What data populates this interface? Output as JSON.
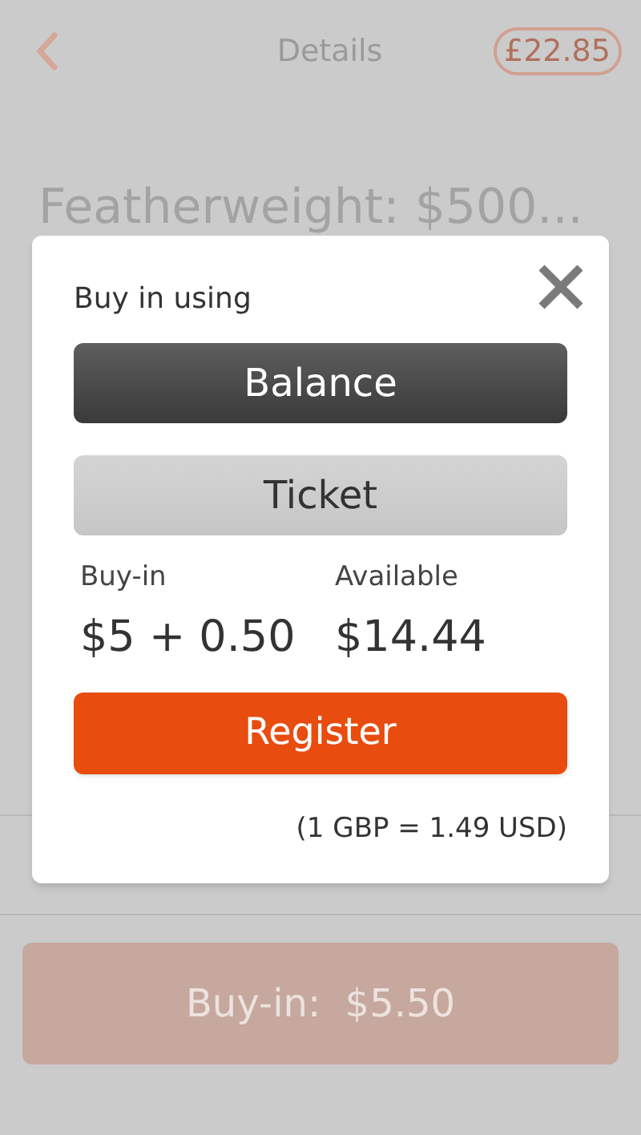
{
  "header": {
    "title": "Details",
    "balance": "£22.85"
  },
  "tournament_title": "Featherweight: $500...",
  "dialog": {
    "heading": "Buy in using",
    "payment_options": [
      {
        "label": "Balance",
        "selected": true
      },
      {
        "label": "Ticket",
        "selected": false
      }
    ],
    "buy_in": {
      "label": "Buy-in",
      "value": "$5 + 0.50"
    },
    "available": {
      "label": "Available",
      "value": "$14.44"
    },
    "register_button": "Register",
    "exchange_rate": "(1 GBP = 1.49 USD)"
  },
  "footer_button": {
    "label": "Buy-in:  $5.50",
    "disabled": true
  }
}
